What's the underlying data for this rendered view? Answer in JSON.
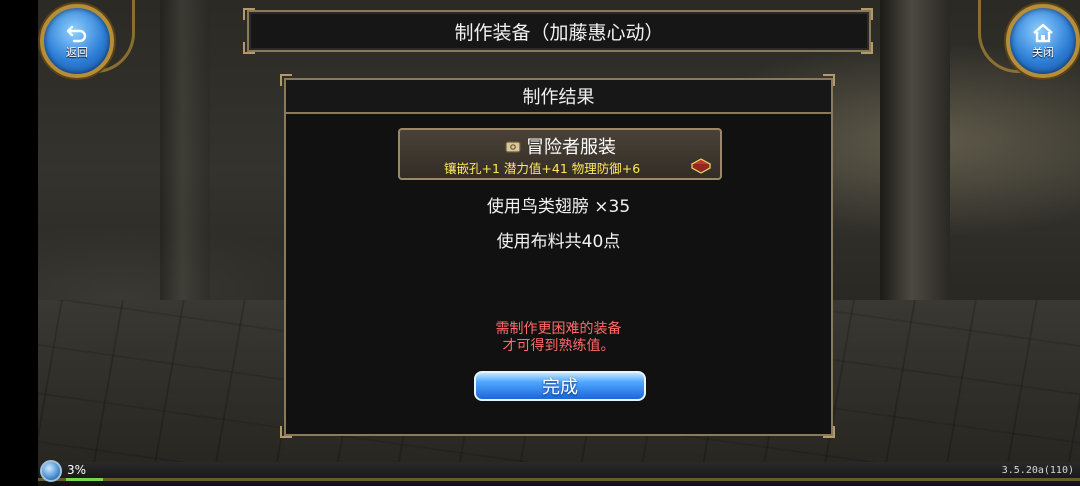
{
  "header": {
    "back_label": "返回",
    "close_label": "关闭",
    "title": "制作装备（加藤惠心动）"
  },
  "panel": {
    "title": "制作结果",
    "item": {
      "name": "冒险者服装",
      "stats": "镶嵌孔+1 潜力值+41 物理防御+6"
    },
    "material_line": "使用鸟类翅膀  ×35",
    "cloth_line": "使用布料共40点",
    "warning_line1": "需制作更困难的装备",
    "warning_line2": "才可得到熟练值。",
    "done_label": "完成"
  },
  "status": {
    "percent": "3%",
    "percent_value": 0.03,
    "version": "3.5.20a(110)"
  },
  "colors": {
    "accent_blue": "#2d7ed6",
    "frame_gold": "#8a7a5a",
    "stat_yellow": "#ffe85a",
    "warning_red": "#ff6a6a"
  },
  "icons": [
    "back-arrow-icon",
    "home-icon",
    "scroll-icon",
    "treasure-chest-icon",
    "status-orb-icon"
  ]
}
